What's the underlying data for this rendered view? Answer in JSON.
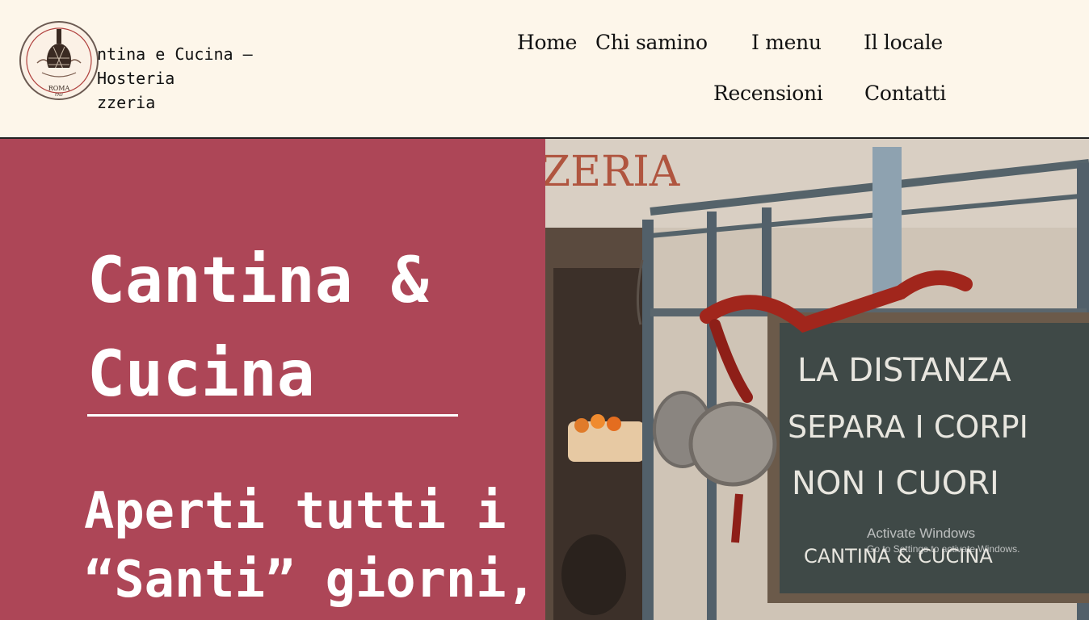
{
  "header": {
    "site_title": "ntina e Cucina – Hosteria zzeria",
    "site_title_line1": "ntina e Cucina – Hosteria",
    "site_title_line2": "zzeria",
    "logo": {
      "icon": "wine-flask-logo",
      "text": "ROMA",
      "subtext": "ITALY"
    }
  },
  "nav": {
    "items": [
      {
        "label": "Home"
      },
      {
        "label": "Chi   samino"
      },
      {
        "label": "I   menu"
      },
      {
        "label": "Il   locale"
      },
      {
        "label": "Recensioni"
      },
      {
        "label": "Contatti"
      }
    ]
  },
  "hero": {
    "title_line1": "Cantina &",
    "title_line2": "Cucina",
    "subtitle_line1": "Aperti tutti i",
    "subtitle_line2": "“Santi” giorni,",
    "photo": {
      "sign_top": "ZERIA",
      "chalkboard_line1": "LA DISTANZA",
      "chalkboard_line2": "SEPARA I CORPI",
      "chalkboard_line3": "NON I CUORI",
      "chalkboard_line4": "CANTINA & CUCINA"
    }
  },
  "watermark": {
    "title": "Activate Windows",
    "subtitle": "Go to Settings to activate Windows."
  },
  "colors": {
    "header_bg": "#fdf6ea",
    "hero_bg": "#ad4657",
    "text_dark": "#111111",
    "text_light": "#ffffff"
  }
}
